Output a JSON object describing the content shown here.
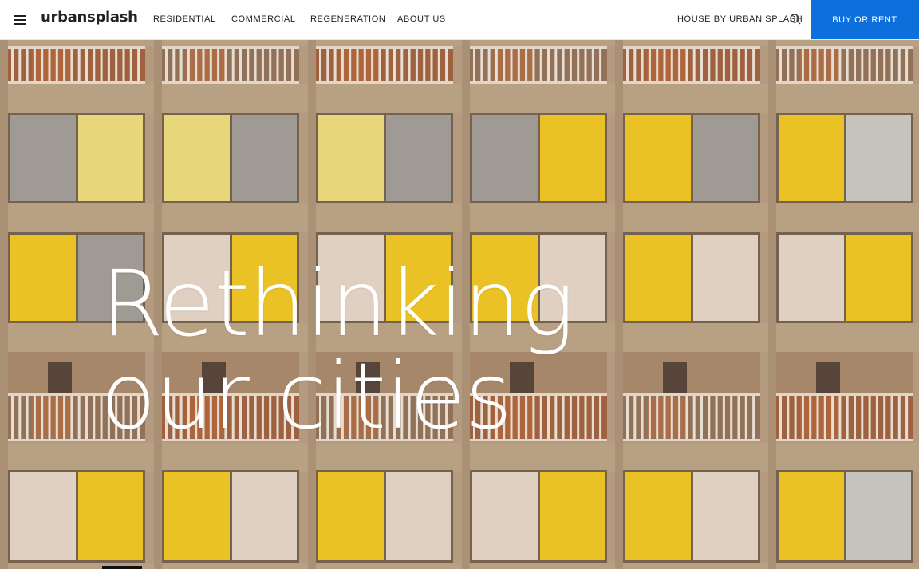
{
  "header": {
    "logo": "urbansplash",
    "nav": [
      {
        "label": "RESIDENTIAL"
      },
      {
        "label": "COMMERCIAL"
      },
      {
        "label": "REGENERATION"
      },
      {
        "label": "ABOUT US"
      }
    ],
    "house_link": "HOUSE BY URBAN SPLASH",
    "cta": "BUY OR RENT",
    "icons": {
      "menu": "menu-icon",
      "search": "search-icon"
    },
    "colors": {
      "cta": "#0d6fdc",
      "background": "#ffffff"
    }
  },
  "hero": {
    "headline_line1": "Rethinking",
    "headline_line2": "our cities",
    "image": "building-facade-yellow-windows"
  }
}
